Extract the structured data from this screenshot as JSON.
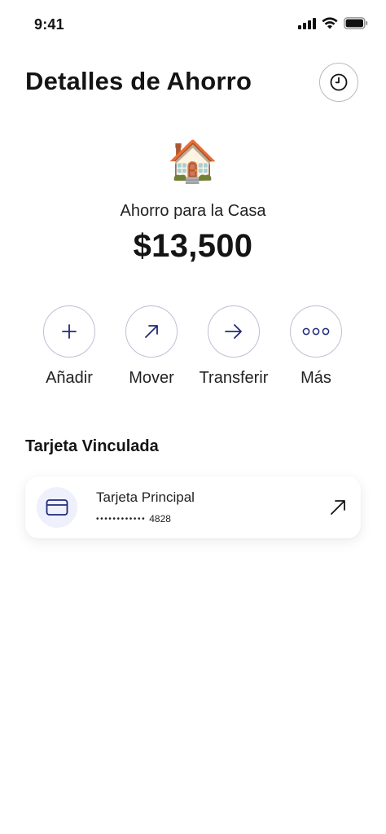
{
  "status_bar": {
    "time": "9:41",
    "icons": [
      "cellular-signal-icon",
      "wifi-icon",
      "battery-icon"
    ]
  },
  "header": {
    "title": "Detalles de Ahorro",
    "history_icon": "clock-icon"
  },
  "goal": {
    "emoji": "🏠",
    "name": "Ahorro para la Casa",
    "amount": "$13,500"
  },
  "actions": [
    {
      "label": "Añadir",
      "icon": "plus-icon"
    },
    {
      "label": "Mover",
      "icon": "arrow-up-right-icon"
    },
    {
      "label": "Transferir",
      "icon": "arrow-right-icon"
    },
    {
      "label": "Más",
      "icon": "more-dots-icon"
    }
  ],
  "linked_card": {
    "section_title": "Tarjeta Vinculada",
    "name": "Tarjeta Principal",
    "masked": "••••••••••••",
    "last4": "4828",
    "icon": "credit-card-icon"
  },
  "colors": {
    "accent": "#1f2a7a",
    "text": "#141414",
    "icon_bg": "#eef0fb",
    "circle_border": "#bfc0d4"
  }
}
